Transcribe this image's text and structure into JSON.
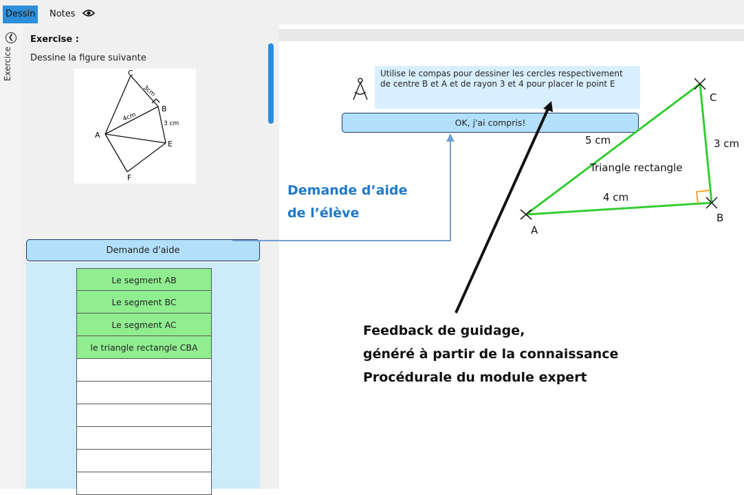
{
  "tabs": {
    "dessin": "Dessin",
    "notes": "Notes"
  },
  "sidebar": {
    "vertical_label": "Exercice"
  },
  "exercise": {
    "title": "Exercise :",
    "instruction": "Dessine la figure suivante",
    "sketch_labels": {
      "c": "C",
      "b": "B",
      "a": "A",
      "e": "E",
      "f": "F",
      "ab": "4cm",
      "bc": "3cm",
      "be": "3 cm"
    }
  },
  "help_button": "Demande d'aide",
  "list_items": [
    "Le segment AB",
    "Le segment BC",
    "Le segment AC",
    "le triangle rectangle CBA",
    "",
    "",
    "",
    "",
    "",
    ""
  ],
  "hint": {
    "text": "Utilise le compas pour dessiner les cercles respectivement de centre B et A et de rayon 3 et 4 pour placer le point E",
    "ok_label": "OK, j'ai compris!"
  },
  "annotations": {
    "blue_line1": "Demande d’aide",
    "blue_line2": "de l’élève",
    "feedback_line1": "Feedback de guidage,",
    "feedback_line2": "généré à partir de la connaissance",
    "feedback_line3": "Procédurale du module expert"
  },
  "figure": {
    "label_a": "A",
    "label_b": "B",
    "label_c": "C",
    "ac_length": "5 cm",
    "bc_length": "3 cm",
    "ab_length": "4 cm",
    "triangle_label": "Triangle rectangle"
  },
  "colors": {
    "accent": "#2d8fd9",
    "button": "#b2e0fb",
    "green": "#90ee90",
    "triangle": "#33cc33",
    "annotation_blue": "#1f78c8"
  },
  "icons": [
    "eye-icon",
    "collapse-icon",
    "compass-icon"
  ]
}
